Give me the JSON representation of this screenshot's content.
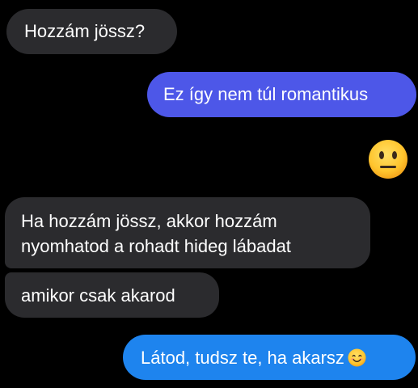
{
  "messages": [
    {
      "id": "m1",
      "sender": "other",
      "text": "Hozzám jössz?"
    },
    {
      "id": "m2",
      "sender": "me",
      "text": "Ez így nem túl romantikus"
    },
    {
      "id": "m3",
      "sender": "me",
      "emoji": "neutral-face-icon"
    },
    {
      "id": "m4",
      "sender": "other",
      "lines": [
        "Ha hozzám jössz, akkor hozzám",
        "nyomhatod a rohadt hideg lábadat"
      ]
    },
    {
      "id": "m5",
      "sender": "other",
      "text": "amikor csak akarod"
    },
    {
      "id": "m6",
      "sender": "me",
      "text": "Látod, tudsz te, ha akarsz",
      "emoji": "smiling-face-icon"
    }
  ],
  "colors": {
    "background": "#000000",
    "incoming_bubble": "#2b2b2e",
    "outgoing_purple": "#4d57e8",
    "outgoing_blue": "#1e84ee",
    "text": "#ffffff"
  }
}
